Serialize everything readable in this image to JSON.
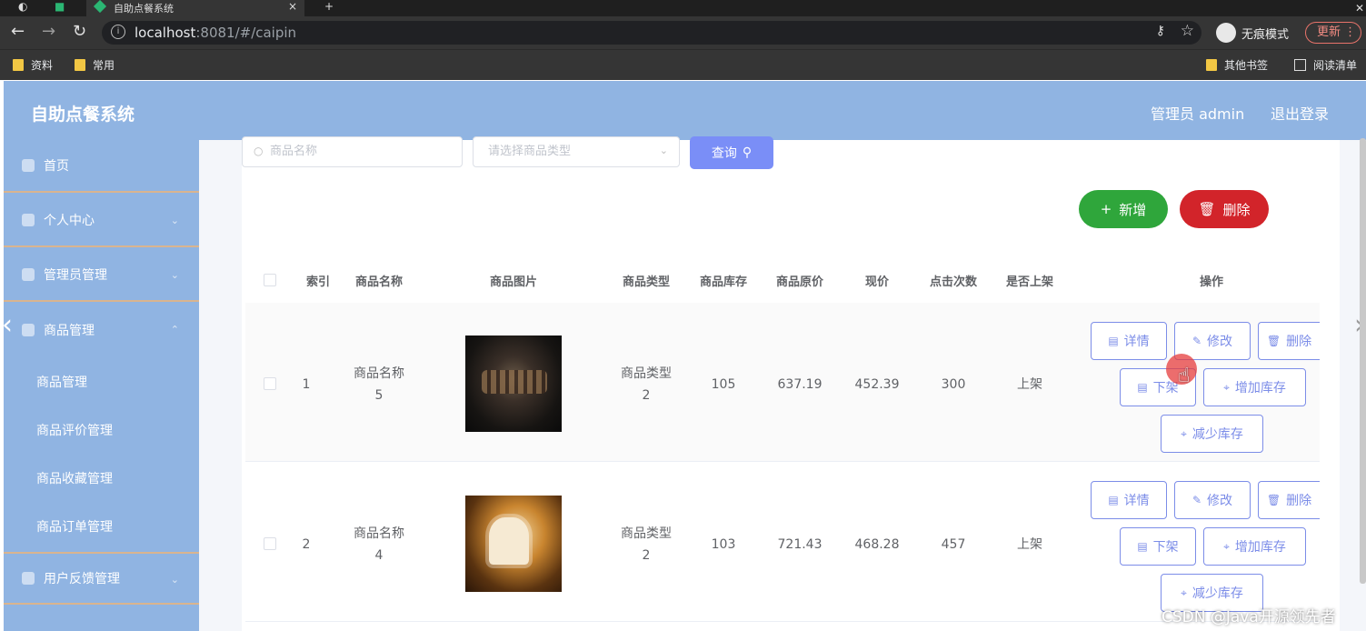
{
  "browser": {
    "tab_title": "自助点餐系统",
    "url_host": "localhost",
    "url_rest": ":8081/#/caipin",
    "incognito_label": "无痕模式",
    "update_label": "更新",
    "bookmarks": [
      "资料",
      "常用"
    ],
    "bookmarks_right": [
      "其他书签",
      "阅读清单"
    ]
  },
  "header": {
    "brand": "自助点餐系统",
    "user": "管理员 admin",
    "logout": "退出登录"
  },
  "sidebar": {
    "items": [
      {
        "label": "首页"
      },
      {
        "label": "个人中心"
      },
      {
        "label": "管理员管理"
      },
      {
        "label": "商品管理"
      }
    ],
    "sub_items": [
      "商品管理",
      "商品评价管理",
      "商品收藏管理",
      "商品订单管理"
    ],
    "after_items": [
      {
        "label": "用户反馈管理"
      }
    ]
  },
  "search": {
    "name_placeholder": "商品名称",
    "type_placeholder": "请选择商品类型",
    "query_label": "查询"
  },
  "actions": {
    "add_label": "新增",
    "delete_label": "删除"
  },
  "table": {
    "columns": [
      "索引",
      "商品名称",
      "商品图片",
      "商品类型",
      "商品库存",
      "商品原价",
      "现价",
      "点击次数",
      "是否上架",
      "操作"
    ],
    "rows": [
      {
        "index": "1",
        "name_a": "商品名称",
        "name_b": "5",
        "type_a": "商品类型",
        "type_b": "2",
        "stock": "105",
        "orig": "637.19",
        "price": "452.39",
        "clicks": "300",
        "status": "上架"
      },
      {
        "index": "2",
        "name_a": "商品名称",
        "name_b": "4",
        "type_a": "商品类型",
        "type_b": "2",
        "stock": "103",
        "orig": "721.43",
        "price": "468.28",
        "clicks": "457",
        "status": "上架"
      }
    ],
    "ops": {
      "detail": "详情",
      "edit": "修改",
      "delete": "删除",
      "offshelf": "下架",
      "add_stock": "增加库存",
      "reduce_stock": "减少库存"
    }
  },
  "watermark": "CSDN @Java开源领先者",
  "colors": {
    "header": "#90b4e2",
    "primary": "#7a8ef7",
    "success": "#2fa63b",
    "danger": "#d2242a"
  }
}
